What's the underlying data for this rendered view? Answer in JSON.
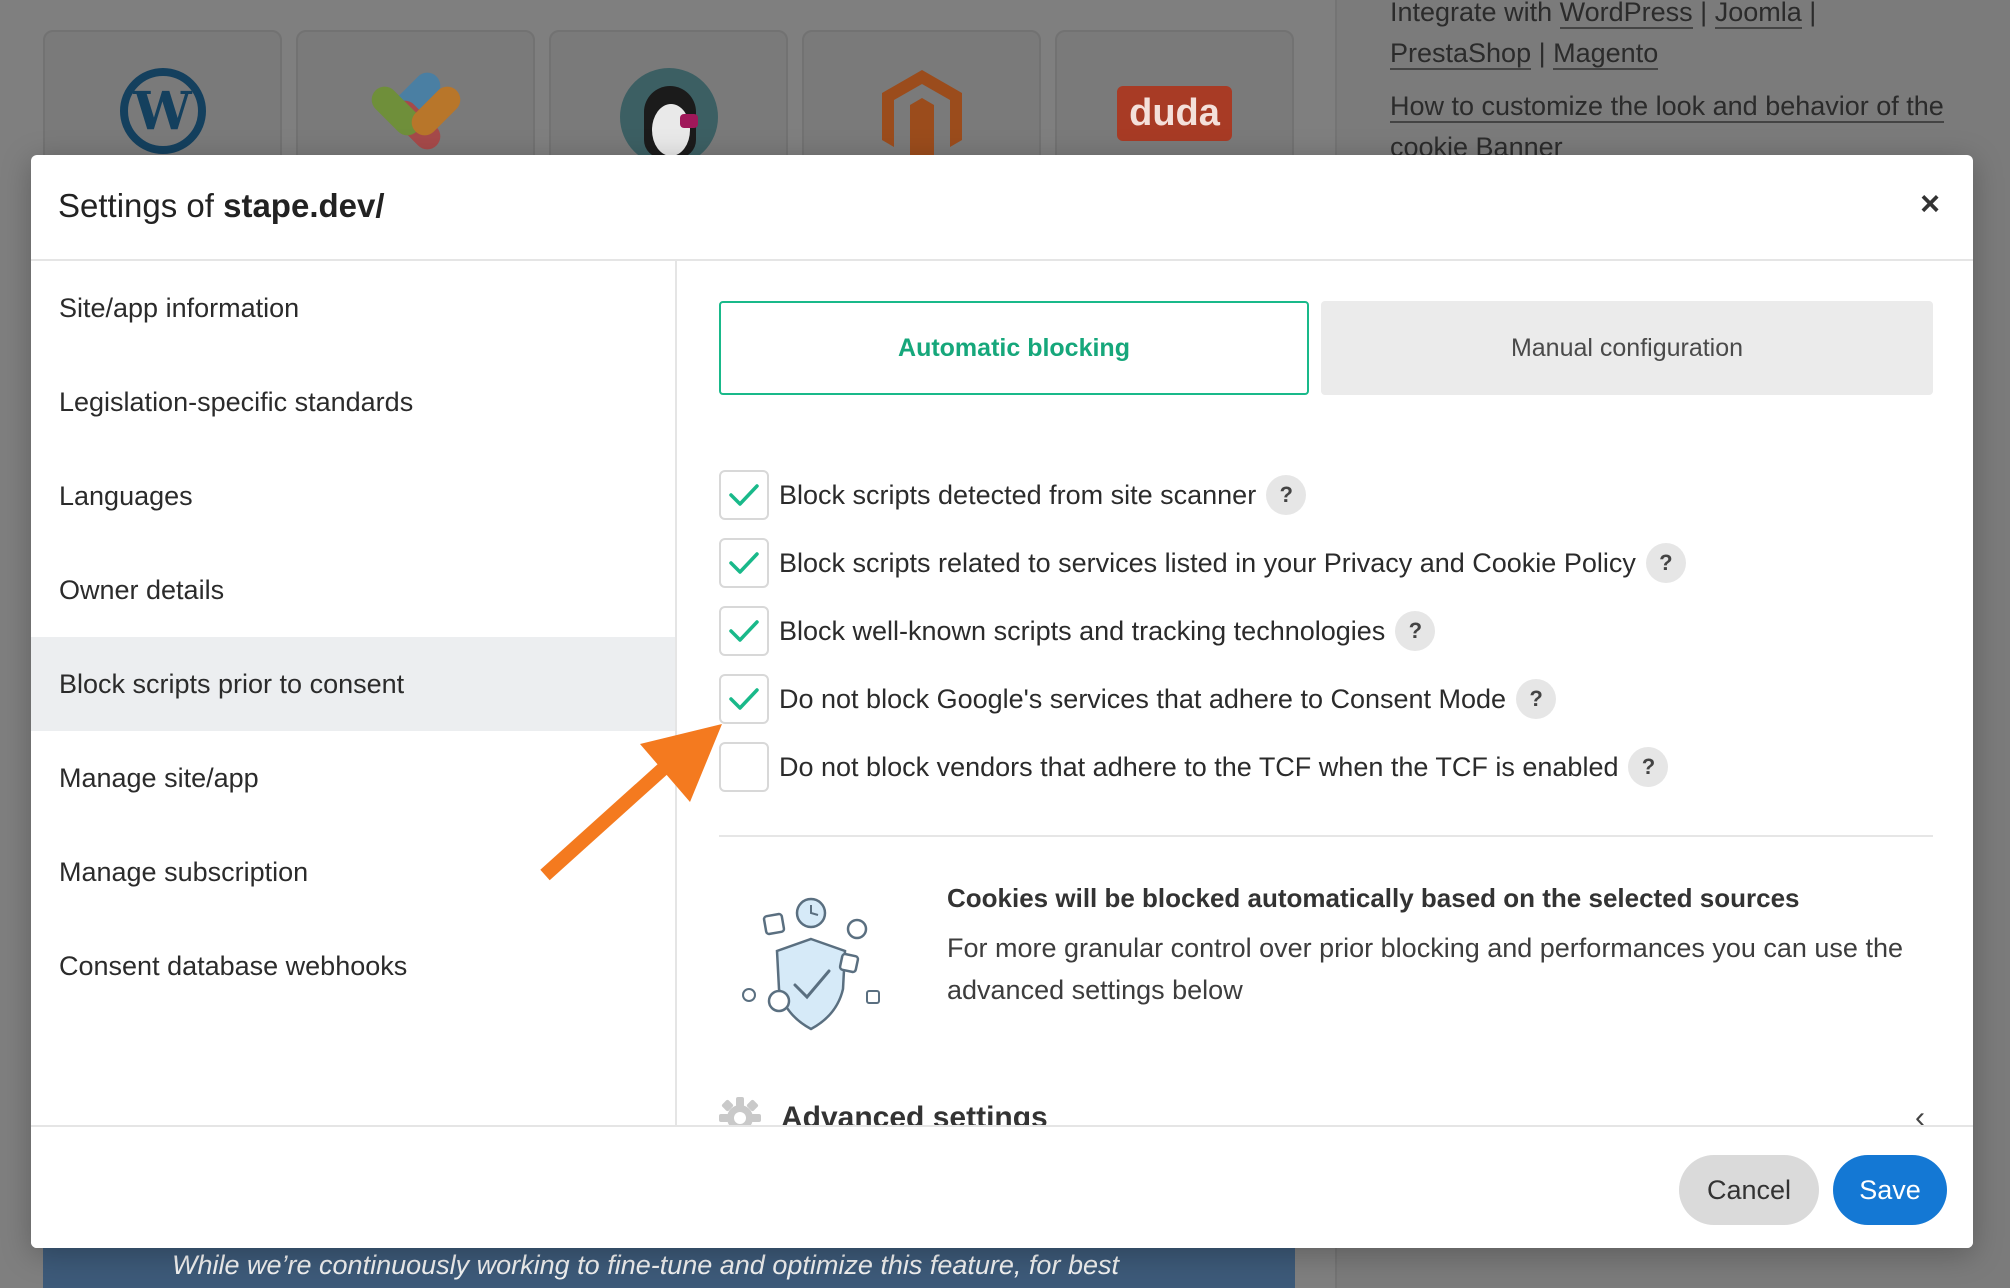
{
  "background": {
    "platform_logos": [
      "wordpress-logo",
      "joomla-logo",
      "prestashop-logo",
      "magento-logo",
      "duda-logo"
    ],
    "duda_text": "duda",
    "wordpress_text": "W",
    "links": {
      "integrate_prefix": "Integrate with",
      "wordpress": "WordPress",
      "sep1": "|",
      "joomla": "Joomla",
      "sep2": "|",
      "prestashop": "PrestaShop",
      "sep3": "|",
      "magento": "Magento",
      "customize": "How to customize the look and behavior of the cookie Banner"
    },
    "footer_text": "While we’re continuously working to fine-tune and optimize this feature, for best"
  },
  "modal": {
    "title_prefix": "Settings of",
    "title_site": "stape.dev/",
    "close_icon": "×",
    "sidebar": [
      {
        "label": "Site/app information",
        "active": false
      },
      {
        "label": "Legislation-specific standards",
        "active": false
      },
      {
        "label": "Languages",
        "active": false
      },
      {
        "label": "Owner details",
        "active": false
      },
      {
        "label": "Block scripts prior to consent",
        "active": true
      },
      {
        "label": "Manage site/app",
        "active": false
      },
      {
        "label": "Manage subscription",
        "active": false
      },
      {
        "label": "Consent database webhooks",
        "active": false
      }
    ],
    "tabs": {
      "automatic": "Automatic blocking",
      "manual": "Manual configuration"
    },
    "options": [
      {
        "label": "Block scripts detected from site scanner",
        "checked": true
      },
      {
        "label": "Block scripts related to services listed in your Privacy and Cookie Policy",
        "checked": true
      },
      {
        "label": "Block well-known scripts and tracking technologies",
        "checked": true
      },
      {
        "label": "Do not block Google's services that adhere to Consent Mode",
        "checked": true
      },
      {
        "label": "Do not block vendors that adhere to the TCF when the TCF is enabled",
        "checked": false
      }
    ],
    "help_glyph": "?",
    "info": {
      "title": "Cookies will be blocked automatically based on the selected sources",
      "body": "For more granular control over prior blocking and performances you can use the advanced settings below"
    },
    "advanced": {
      "label": "Advanced settings",
      "chevron": "‹"
    },
    "footer": {
      "cancel": "Cancel",
      "save": "Save"
    }
  },
  "colors": {
    "accent_green": "#19b98a",
    "save_blue": "#1478d4",
    "annotation_arrow": "#f47a1f"
  }
}
